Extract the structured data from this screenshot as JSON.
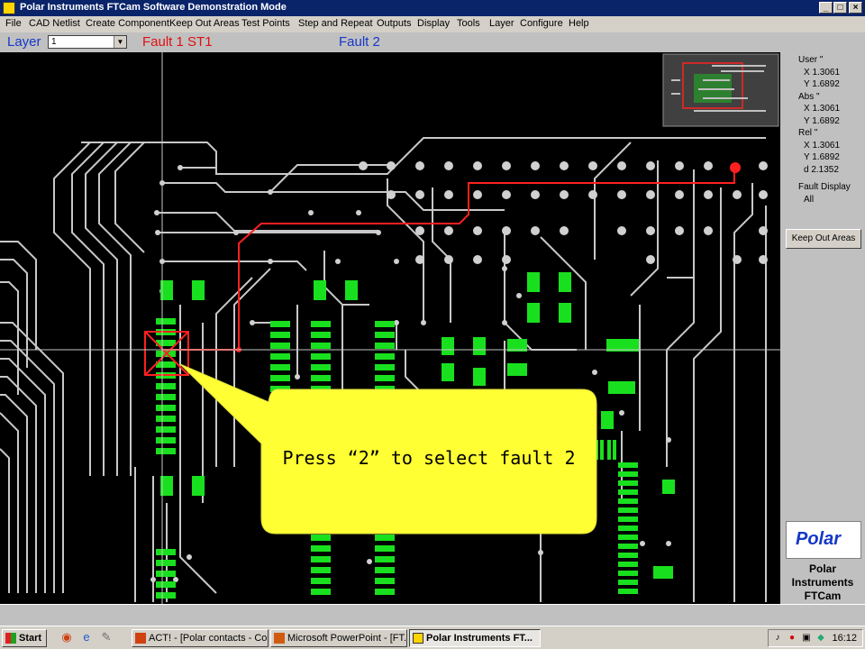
{
  "window": {
    "title": "Polar Instruments FTCam Software  Demonstration Mode",
    "min": "_",
    "max": "□",
    "close": "×"
  },
  "menu": [
    "File",
    "CAD Netlist",
    "Create Component",
    "Keep Out Areas",
    "Test Points",
    "Step and Repeat",
    "Outputs",
    "Display",
    "Tools",
    "Layer",
    "Configure",
    "Help"
  ],
  "toolbar": {
    "layer_label": "Layer",
    "layer_value": "1",
    "fault1": "Fault 1  ST1",
    "fault2": "Fault 2"
  },
  "coords": {
    "user_label": "User \"",
    "user_x": "X 1.3061",
    "user_y": "Y 1.6892",
    "abs_label": "Abs \"",
    "abs_x": "X 1.3061",
    "abs_y": "Y 1.6892",
    "rel_label": "Rel \"",
    "rel_x": "X 1.3061",
    "rel_y": "Y 1.6892",
    "rel_d": "d 2.1352",
    "fault_display_label": "Fault Display",
    "fault_display_value": "All"
  },
  "keep_out_button": "Keep Out Areas",
  "logo": {
    "text": "Polar",
    "line1": "Polar",
    "line2": "Instruments",
    "line3": "FTCam"
  },
  "callout": {
    "text": "Press “2” to select fault 2"
  },
  "taskbar": {
    "start": "Start",
    "tasks": [
      "ACT! - [Polar contacts - Co...",
      "Microsoft PowerPoint - [FT...",
      "Polar Instruments FT..."
    ],
    "clock": "16:12"
  },
  "colors": {
    "trace": "#c8c8c8",
    "pad": "#19e01e",
    "fault": "#ff2020",
    "callout": "#ffff33",
    "title": "#0a246a"
  }
}
